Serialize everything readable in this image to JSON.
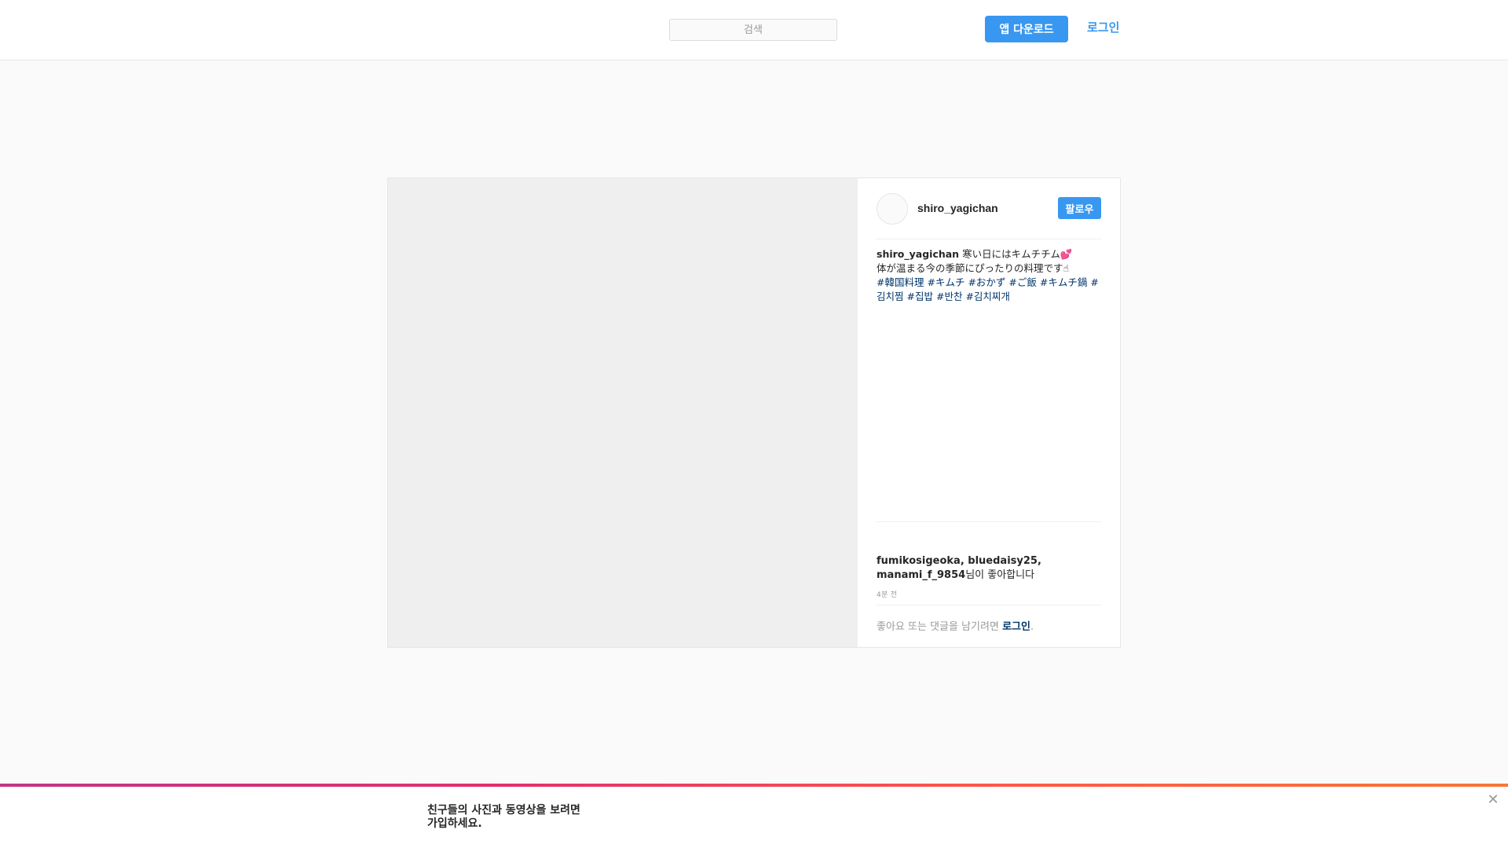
{
  "colors": {
    "accent": "#3897f0",
    "link_dark": "#003569",
    "border": "#e6e6e6",
    "page_bg": "#fafafa",
    "media_placeholder": "#efefef"
  },
  "header": {
    "search": {
      "placeholder": "검색",
      "value": ""
    },
    "app_download_label": "앱 다운로드",
    "login_label": "로그인"
  },
  "post": {
    "author": {
      "username": "shiro_yagichan",
      "avatar_icon": "avatar-placeholder"
    },
    "follow_label": "팔로우",
    "caption": {
      "username": "shiro_yagichan",
      "line1": "寒い日にはキムチチム💕",
      "line2": "体が温まる今の季節にぴったりの料理です☝",
      "hashtags": [
        "#韓国料理",
        "#キムチ",
        "#おかず",
        "#ご飯",
        "#キムチ鍋",
        "#김치찜",
        "#집밥",
        "#반찬",
        "#김치찌개"
      ]
    },
    "likes": {
      "users": [
        "fumikosigeoka",
        "bluedaisy25",
        "manami_f_9854"
      ],
      "suffix": "님이 좋아합니다"
    },
    "timestamp": "4분 전",
    "comment_prompt": {
      "text": "좋아요 또는 댓글을 남기려면",
      "login_label": "로그인",
      "end": "."
    }
  },
  "signup_banner": {
    "line1": "친구들의 사진과 동영상을 보려면",
    "line2": "가입하세요.",
    "close_icon": "close-icon"
  }
}
